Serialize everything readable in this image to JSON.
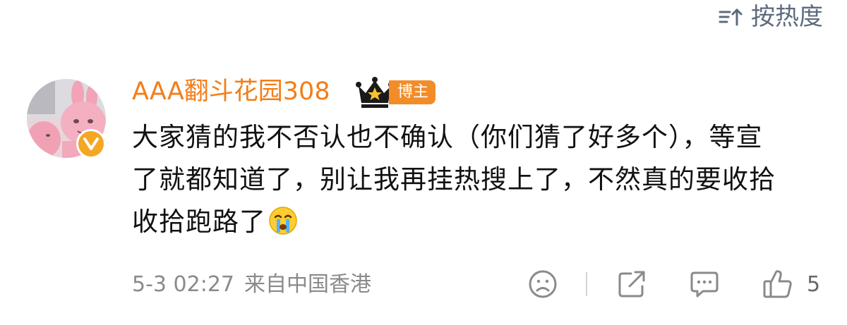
{
  "sort": {
    "label": "按热度",
    "icon": "sort-icon"
  },
  "comment": {
    "username": "AAA翻斗花园308",
    "badge_label": "博主",
    "text": "大家猜的我不否认也不确认（你们猜了好多个），等宣了就都知道了，别让我再挂热搜上了，不然真的要收拾收拾跑路了",
    "emoji": "crying-face-emoji",
    "timestamp": "5-3 02:27",
    "location": "来自中国香港",
    "like_count": "5"
  },
  "actions": [
    "emoji-reaction-icon",
    "share-icon",
    "reply-icon",
    "like-icon"
  ],
  "colors": {
    "username": "#f27e1a",
    "badge_bg": "#f28c28",
    "verified_bg": "#f5a623",
    "meta_text": "#8a8a8a",
    "sort_text": "#5d6b7e",
    "body_text": "#111111"
  }
}
